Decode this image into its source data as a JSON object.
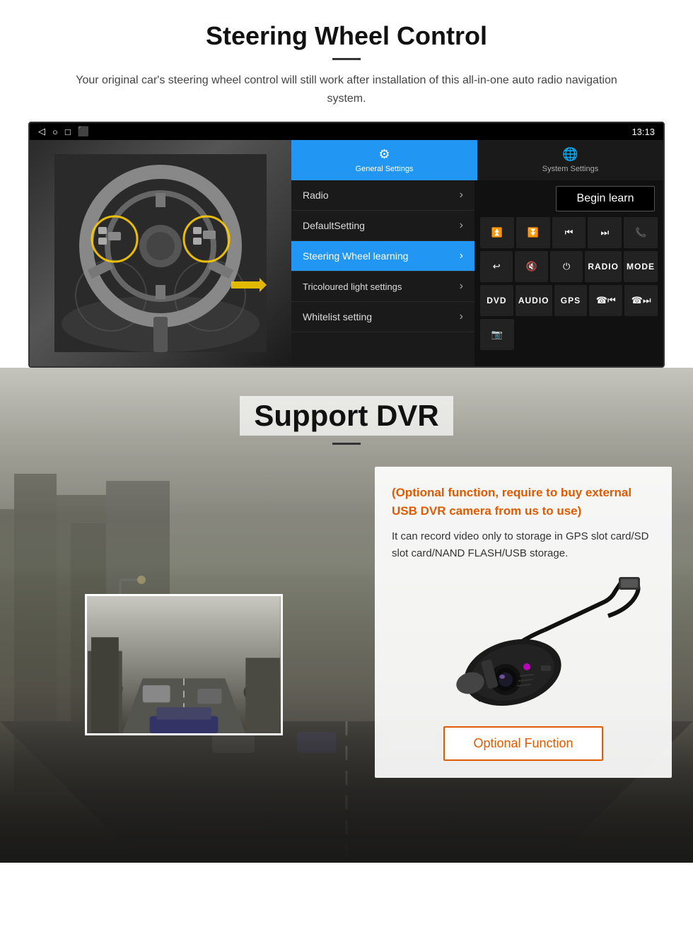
{
  "steering_section": {
    "title": "Steering Wheel Control",
    "subtitle": "Your original car's steering wheel control will still work after installation of this all-in-one auto radio navigation system.",
    "statusbar": {
      "time": "13:13",
      "icons": [
        "◁",
        "○",
        "□",
        "⬛"
      ]
    },
    "tabs": [
      {
        "label": "General Settings",
        "icon": "⚙",
        "active": true
      },
      {
        "label": "System Settings",
        "icon": "🌐",
        "active": false
      }
    ],
    "menu_items": [
      {
        "label": "Radio",
        "active": false
      },
      {
        "label": "DefaultSetting",
        "active": false
      },
      {
        "label": "Steering Wheel learning",
        "active": true
      },
      {
        "label": "Tricoloured light settings",
        "active": false
      },
      {
        "label": "Whitelist setting",
        "active": false
      }
    ],
    "begin_learn_label": "Begin learn",
    "control_buttons": [
      {
        "label": "⏮+",
        "row": 1
      },
      {
        "label": "⏮-",
        "row": 1
      },
      {
        "label": "⏮",
        "row": 1
      },
      {
        "label": "⏭",
        "row": 1
      },
      {
        "label": "📞",
        "row": 1
      },
      {
        "label": "↩",
        "row": 2
      },
      {
        "label": "🔇",
        "row": 2
      },
      {
        "label": "⏻",
        "row": 2
      },
      {
        "label": "RADIO",
        "row": 2
      },
      {
        "label": "MODE",
        "row": 2
      },
      {
        "label": "DVD",
        "row": 3
      },
      {
        "label": "AUDIO",
        "row": 3
      },
      {
        "label": "GPS",
        "row": 3
      },
      {
        "label": "⏮",
        "row": 3
      },
      {
        "label": "⏭",
        "row": 3
      },
      {
        "label": "📷",
        "row": 4
      }
    ]
  },
  "dvr_section": {
    "title": "Support DVR",
    "card_title": "(Optional function, require to buy external USB DVR camera from us to use)",
    "card_text": "It can record video only to storage in GPS slot card/SD slot card/NAND FLASH/USB storage.",
    "optional_function_label": "Optional Function"
  }
}
